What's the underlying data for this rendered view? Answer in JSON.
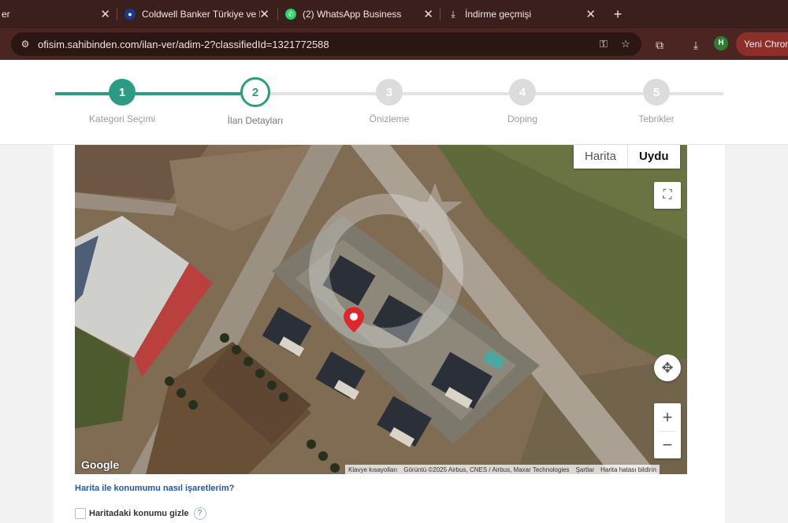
{
  "browser": {
    "tabs": [
      {
        "title": "er",
        "icon": ""
      },
      {
        "title": "Coldwell Banker Türkiye ve Kıbrıs",
        "icon": "coldwell-banker-icon"
      },
      {
        "title": "(2) WhatsApp Business",
        "icon": "whatsapp-icon"
      },
      {
        "title": "İndirme geçmişi",
        "icon": "download-icon"
      }
    ],
    "url": "ofisim.sahibinden.com/ilan-ver/adim-2?classifiedId=1321772588",
    "profile_initial": "H",
    "chrome_button": "Yeni Chrome"
  },
  "stepper": {
    "steps": [
      {
        "number": "1",
        "label": "Kategori Seçimi",
        "state": "done"
      },
      {
        "number": "2",
        "label": "İlan Detayları",
        "state": "active"
      },
      {
        "number": "3",
        "label": "Önizleme",
        "state": "todo"
      },
      {
        "number": "4",
        "label": "Doping",
        "state": "todo"
      },
      {
        "number": "5",
        "label": "Tebrikler",
        "state": "todo"
      }
    ]
  },
  "map": {
    "type_buttons": {
      "map": "Harita",
      "satellite": "Uydu"
    },
    "selected_type": "Uydu",
    "zoom_in": "+",
    "zoom_out": "−",
    "google": "Google",
    "attribution": {
      "shortcuts": "Klavye kısayolları",
      "imagery": "Görüntü ©2025 Airbus, CNES / Airbus, Maxar Technologies",
      "terms": "Şartlar",
      "report": "Harita hatası bildirin"
    },
    "accent_marker": "#e0252b"
  },
  "location_help": "Harita ile konumumu nasıl işaretlerim?",
  "hide_location_label": "Haritadaki konumu gizle",
  "colors": {
    "accent": "#2b9c83",
    "tabbar": "#3b1f1c",
    "link": "#1f57b9"
  }
}
